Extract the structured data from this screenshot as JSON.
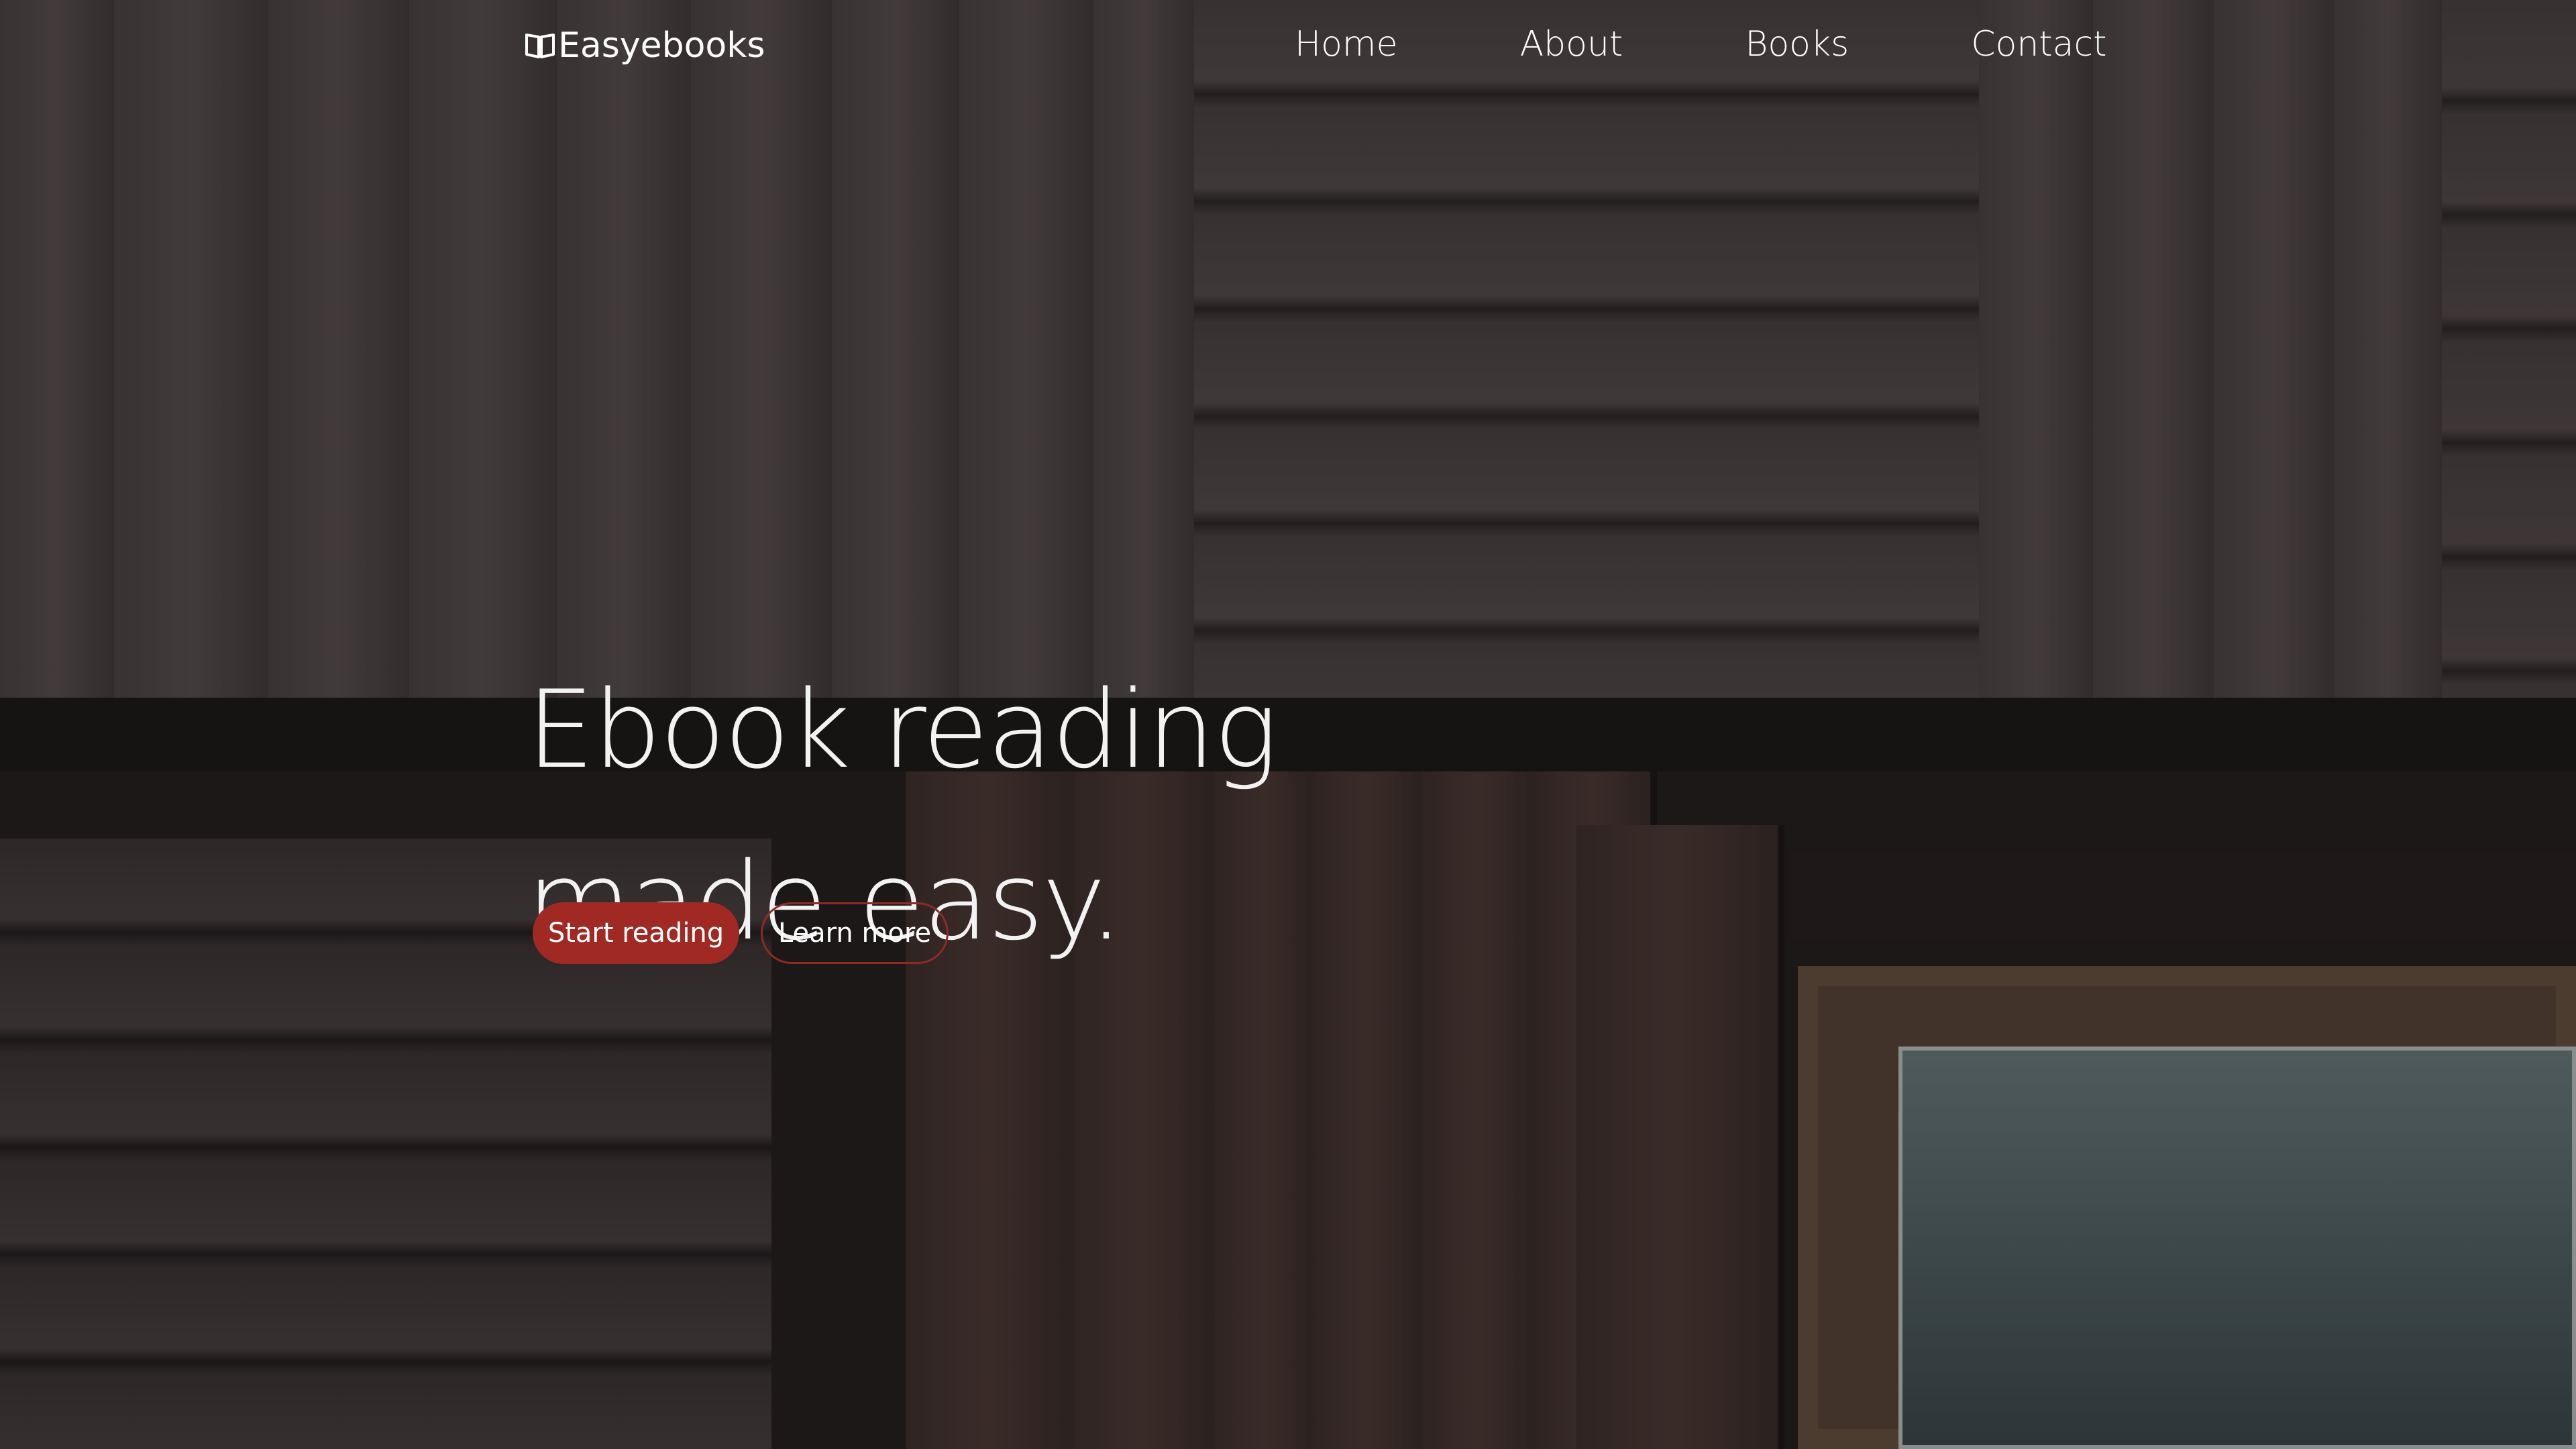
{
  "brand": {
    "name": "Easyebooks",
    "icon": "open-book-icon"
  },
  "nav": {
    "items": [
      {
        "label": "Home"
      },
      {
        "label": "About"
      },
      {
        "label": "Books"
      },
      {
        "label": "Contact"
      }
    ]
  },
  "hero": {
    "headline_line1": "Ebook reading",
    "headline_line2": "made easy.",
    "primary_cta": "Start reading",
    "secondary_cta": "Learn more"
  },
  "colors": {
    "accent": "#a02a23",
    "text": "#ffffff"
  }
}
